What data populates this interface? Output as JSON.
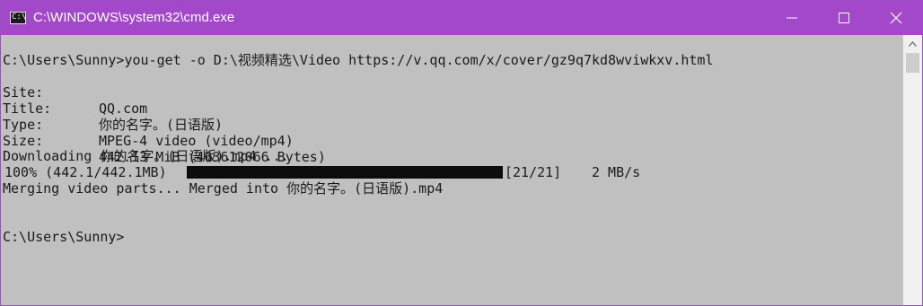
{
  "window": {
    "title": "C:\\WINDOWS\\system32\\cmd.exe",
    "icon": "cmd-icon",
    "buttons": [
      "minimize-icon",
      "maximize-icon",
      "close-icon"
    ]
  },
  "console": {
    "command_line": "C:\\Users\\Sunny>you-get -o D:\\视频精选\\Video https://v.qq.com/x/cover/gz9q7kd8wviwkxv.html",
    "fields": [
      {
        "label": "Site:",
        "value": "QQ.com"
      },
      {
        "label": "Title:",
        "value": "你的名字。(日语版)"
      },
      {
        "label": "Type:",
        "value": "MPEG-4 video (video/mp4)"
      },
      {
        "label": "Size:",
        "value": "442.13 MiB (463612066 Bytes)"
      }
    ],
    "downloading_line": "Downloading 你的名字。(日语版).mp4 ...",
    "progress": {
      "percent_text": "100% (442.1/442.1MB)",
      "fraction": 1.0,
      "count_text": "[21/21]",
      "speed_text": "2 MB/s"
    },
    "merge_line": "Merging video parts... Merged into 你的名字。(日语版).mp4",
    "final_prompt": "C:\\Users\\Sunny>"
  },
  "colors": {
    "titlebar": "#a348c9",
    "console_bg": "#c0c0c0",
    "console_text": "#1a1a1a",
    "progress_fill": "#0c0c0c"
  }
}
